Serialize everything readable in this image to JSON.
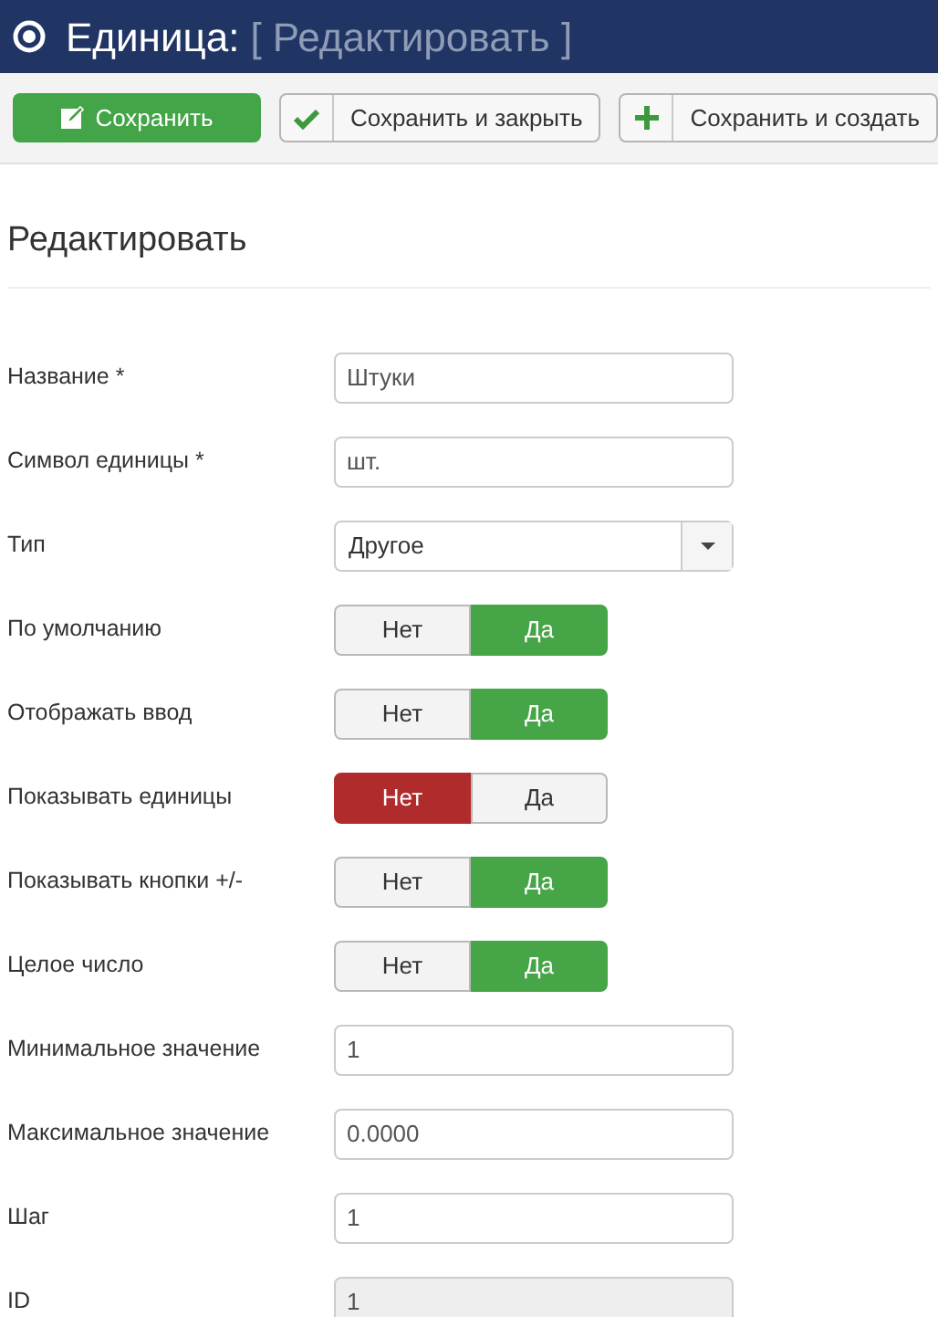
{
  "header": {
    "title": "Единица:",
    "subtitle": "[ Редактировать ]"
  },
  "toolbar": [
    {
      "kind": "save",
      "label": "Сохранить"
    },
    {
      "kind": "save-close",
      "label": "Сохранить и закрыть"
    },
    {
      "kind": "save-new",
      "label": "Сохранить и создать"
    }
  ],
  "section_title": "Редактировать",
  "fields": [
    {
      "kind": "text",
      "label": "Название *",
      "value": "Штуки"
    },
    {
      "kind": "text",
      "label": "Символ единицы *",
      "value": "шт."
    },
    {
      "kind": "select",
      "label": "Тип",
      "value": "Другое"
    },
    {
      "kind": "toggle",
      "label": "По умолчанию",
      "options": [
        {
          "label": "Нет",
          "selected": false
        },
        {
          "label": "Да",
          "selected": true
        }
      ]
    },
    {
      "kind": "toggle",
      "label": "Отображать ввод",
      "options": [
        {
          "label": "Нет",
          "selected": false
        },
        {
          "label": "Да",
          "selected": true
        }
      ]
    },
    {
      "kind": "toggle",
      "label": "Показывать единицы",
      "options": [
        {
          "label": "Нет",
          "selected": true
        },
        {
          "label": "Да",
          "selected": false
        }
      ]
    },
    {
      "kind": "toggle",
      "label": "Показывать кнопки +/-",
      "options": [
        {
          "label": "Нет",
          "selected": false
        },
        {
          "label": "Да",
          "selected": true
        }
      ]
    },
    {
      "kind": "toggle",
      "label": "Целое число",
      "options": [
        {
          "label": "Нет",
          "selected": false
        },
        {
          "label": "Да",
          "selected": true
        }
      ]
    },
    {
      "kind": "text",
      "label": "Минимальное значение",
      "value": "1"
    },
    {
      "kind": "text",
      "label": "Максимальное значение",
      "value": "0.0000"
    },
    {
      "kind": "text",
      "label": "Шаг",
      "value": "1"
    },
    {
      "kind": "text",
      "label": "ID",
      "value": "1",
      "disabled": true
    }
  ]
}
